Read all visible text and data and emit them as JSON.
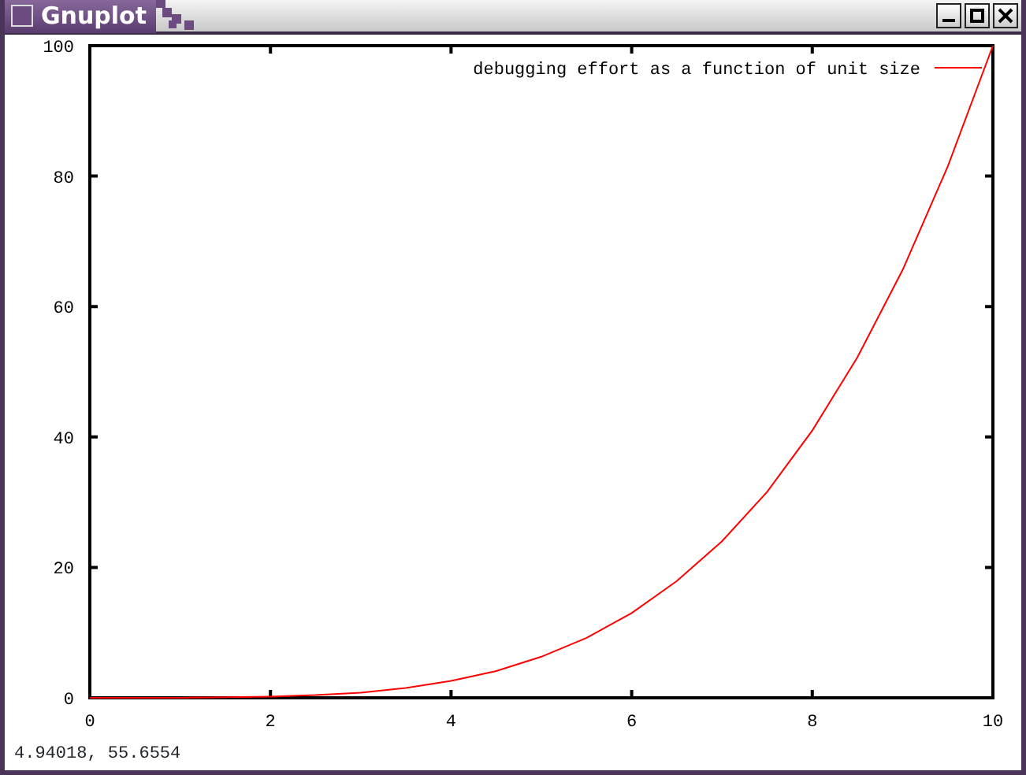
{
  "window": {
    "title": "Gnuplot"
  },
  "plot": {
    "chart_data": {
      "type": "line",
      "xlim": [
        0,
        10
      ],
      "ylim": [
        0,
        100
      ],
      "xticks": [
        0,
        2,
        4,
        6,
        8,
        10
      ],
      "yticks": [
        0,
        20,
        40,
        60,
        80,
        100
      ],
      "x": [
        0,
        0.5,
        1,
        1.5,
        2,
        2.5,
        3,
        3.5,
        4,
        4.5,
        5,
        5.5,
        6,
        6.5,
        7,
        7.5,
        8,
        8.5,
        9,
        9.5,
        10
      ],
      "series": [
        {
          "name": "debugging effort as a function of unit size",
          "color": "#ff0000",
          "values": [
            0,
            0,
            0,
            0.1,
            0.2,
            0.4,
            0.8,
            1.5,
            2.6,
            4.1,
            6.3,
            9.2,
            13,
            17.9,
            24,
            31.6,
            41,
            52.2,
            65.6,
            81.5,
            100
          ]
        }
      ]
    }
  },
  "status_bar": "4.94018,  55.6554"
}
